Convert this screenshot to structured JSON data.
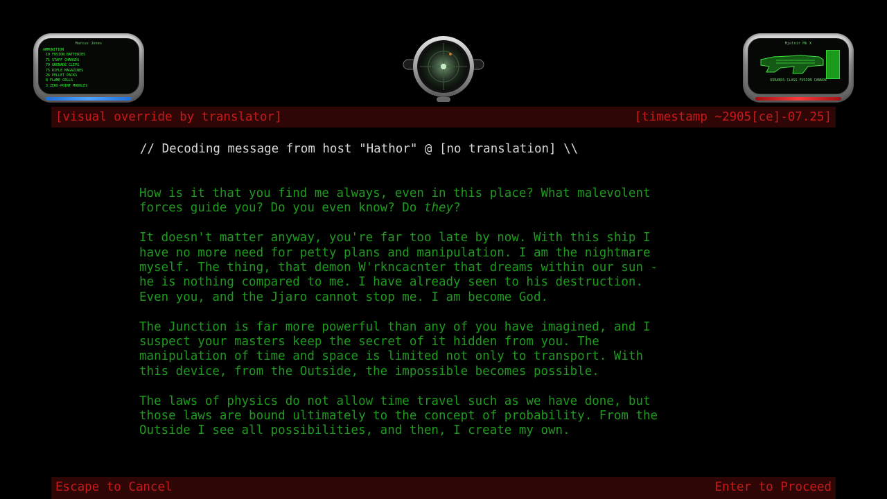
{
  "hud": {
    "left_panel": {
      "title": "Marcus Jones",
      "header": "AMMUNITION",
      "items": [
        "10 FUSION BATTERIES",
        "71 STAFF CHARGES",
        "79 GRENADE CLIPS",
        "75 RIFLE MAGAZINES",
        "26 PELLET PACKS",
        "8 FLAME CELLS",
        "3 ZERO-POINT MODULES"
      ]
    },
    "right_panel": {
      "title": "Mjolnir Mk X",
      "weapon_name": "DURANDS-CLASS FUSION CANNON"
    },
    "colors": {
      "screen_text": "#33ff33",
      "left_bar": "#4fa3ff",
      "right_bar": "#ff3a3a"
    },
    "icons": [
      "radar-icon",
      "weapon-icon"
    ]
  },
  "top_bar": {
    "left": "[visual override by translator]",
    "right": "[timestamp ~2905[ce]-07.25]"
  },
  "message": {
    "header": "// Decoding message from host \"Hathor\" @ [no translation] \\\\",
    "paragraphs": [
      [
        "How is it that you find me always, even in this place? What malevolent",
        "forces guide you? Do you even know? Do ",
        "they",
        "?"
      ],
      [
        "It doesn't matter anyway, you're far too late by now. With this ship I",
        "have no more need for petty plans and manipulation. I am the nightmare",
        "myself. The thing, that demon W'rkncacnter that dreams within our sun -",
        "he is nothing compared to me. I have already seen to his destruction.",
        "Even you, and the Jjaro cannot stop me. I am become God."
      ],
      [
        "The Junction is far more powerful than any of you have imagined, and I",
        "suspect your masters keep the secret of it hidden from you. The",
        "manipulation of time and space is limited not only to transport. With",
        "this device, from the Outside, the impossible becomes possible."
      ],
      [
        "The laws of physics do not allow time travel such as we have done, but",
        "those laws are bound ultimately to the concept of probability. From the",
        "Outside I see all possibilities, and then, I create my own."
      ]
    ]
  },
  "bottom_bar": {
    "left": "Escape to Cancel",
    "right": "Enter to Proceed"
  }
}
